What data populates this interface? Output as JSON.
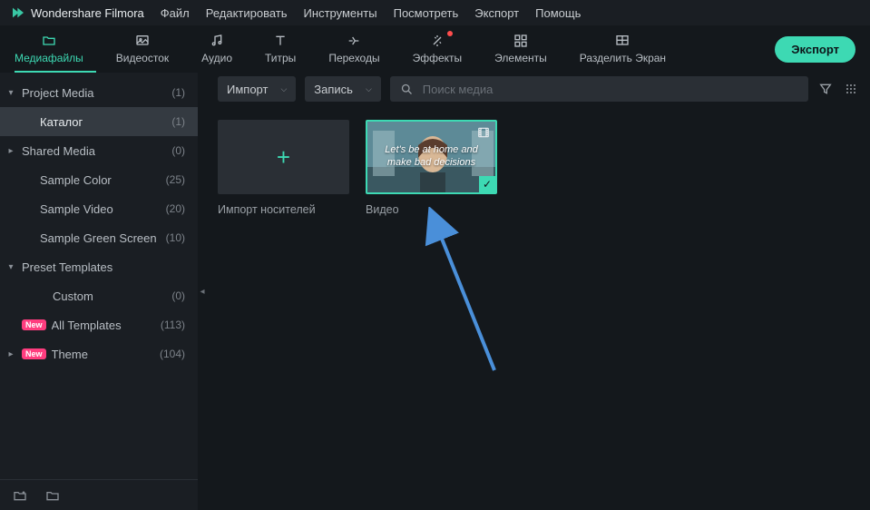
{
  "app_title": "Wondershare Filmora",
  "menus": [
    "Файл",
    "Редактировать",
    "Инструменты",
    "Посмотреть",
    "Экспорт",
    "Помощь"
  ],
  "tools": [
    {
      "id": "media",
      "label": "Медиафайлы",
      "icon": "folder",
      "active": true
    },
    {
      "id": "stock",
      "label": "Видеосток",
      "icon": "image"
    },
    {
      "id": "audio",
      "label": "Аудио",
      "icon": "music"
    },
    {
      "id": "titles",
      "label": "Титры",
      "icon": "text"
    },
    {
      "id": "transitions",
      "label": "Переходы",
      "icon": "transition"
    },
    {
      "id": "effects",
      "label": "Эффекты",
      "icon": "sparkle",
      "dot": true
    },
    {
      "id": "elements",
      "label": "Элементы",
      "icon": "elements"
    },
    {
      "id": "split",
      "label": "Разделить Экран",
      "icon": "split"
    }
  ],
  "export_label": "Экспорт",
  "sidebar": {
    "items": [
      {
        "label": "Project Media",
        "count": 1,
        "chevron": "down"
      },
      {
        "label": "Каталог",
        "count": 1,
        "indent": 1,
        "selected": true
      },
      {
        "label": "Shared Media",
        "count": 0,
        "chevron": "right"
      },
      {
        "label": "Sample Color",
        "count": 25,
        "indent": 1
      },
      {
        "label": "Sample Video",
        "count": 20,
        "indent": 1
      },
      {
        "label": "Sample Green Screen",
        "count": 10,
        "indent": 1
      },
      {
        "label": "Preset Templates",
        "chevron": "down"
      },
      {
        "label": "Custom",
        "count": 0,
        "indent": 2
      },
      {
        "label": "All Templates",
        "count": 113,
        "badge": "New",
        "indent_badge": true
      },
      {
        "label": "Theme",
        "count": 104,
        "chevron": "right",
        "badge": "New"
      }
    ]
  },
  "main_top": {
    "import_label": "Импорт",
    "record_label": "Запись",
    "search_placeholder": "Поиск медиа"
  },
  "media": {
    "import_tile_label": "Импорт носителей",
    "video_tile_label": "Видео",
    "video_overlay_line1": "Let's be at home and",
    "video_overlay_line2": "make bad decisions"
  }
}
